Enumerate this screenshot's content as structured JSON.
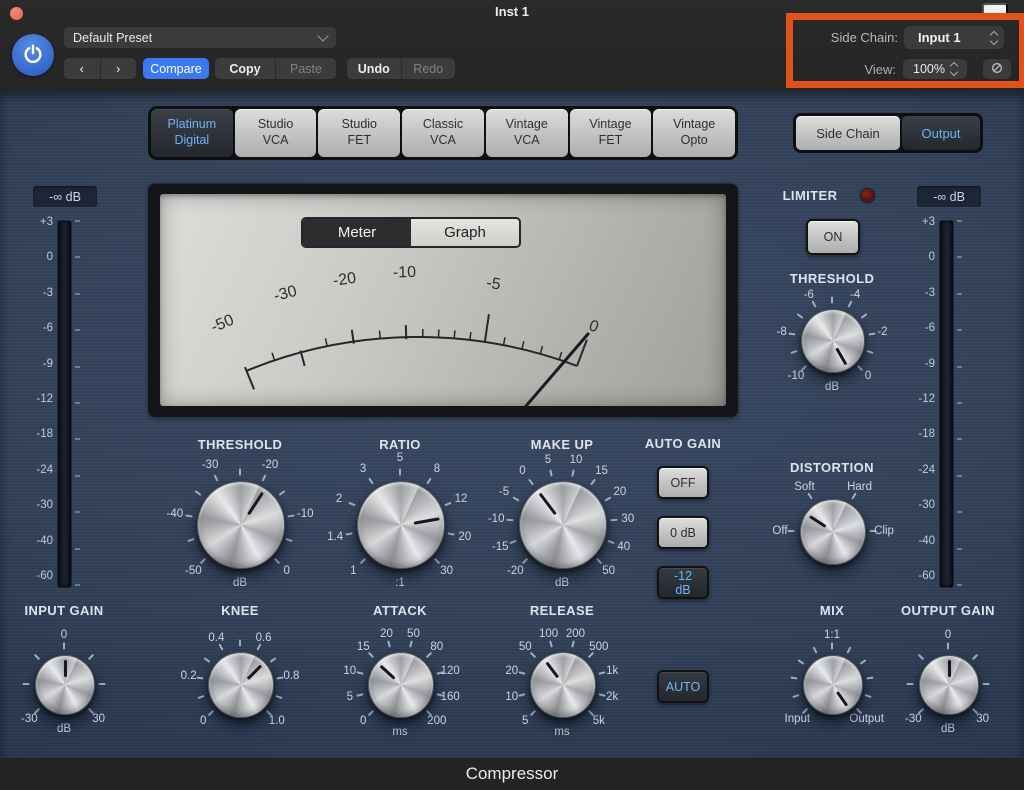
{
  "window": {
    "title": "Inst 1"
  },
  "header": {
    "preset": "Default Preset",
    "prev": "‹",
    "next": "›",
    "compare": "Compare",
    "copy": "Copy",
    "paste": "Paste",
    "undo": "Undo",
    "redo": "Redo",
    "side_chain_label": "Side Chain:",
    "side_chain_value": "Input 1",
    "view_label": "View:",
    "view_value": "100%"
  },
  "models": [
    {
      "label": "Platinum\nDigital",
      "selected": true
    },
    {
      "label": "Studio\nVCA",
      "selected": false
    },
    {
      "label": "Studio\nFET",
      "selected": false
    },
    {
      "label": "Classic\nVCA",
      "selected": false
    },
    {
      "label": "Vintage\nVCA",
      "selected": false
    },
    {
      "label": "Vintage\nFET",
      "selected": false
    },
    {
      "label": "Vintage\nOpto",
      "selected": false
    }
  ],
  "io_toggle": {
    "side_chain": "Side Chain",
    "output": "Output",
    "selected": "Output"
  },
  "vu": {
    "tabs": [
      "Meter",
      "Graph"
    ],
    "selected_tab": "Meter",
    "scale": [
      "-50",
      "-30",
      "-20",
      "-10",
      "-5",
      "0"
    ]
  },
  "limiter": {
    "label": "LIMITER",
    "on": "ON"
  },
  "auto_gain": {
    "label": "AUTO GAIN",
    "options": [
      "OFF",
      "0 dB",
      "-12 dB"
    ],
    "selected": "-12 dB"
  },
  "release_auto": {
    "label": "AUTO",
    "active": true
  },
  "meters": {
    "input": {
      "readout": "-∞ dB",
      "scale": [
        "+3",
        "0",
        "-3",
        "-6",
        "-9",
        "-12",
        "-18",
        "-24",
        "-30",
        "-40",
        "-60"
      ]
    },
    "output": {
      "readout": "-∞ dB",
      "scale": [
        "+3",
        "0",
        "-3",
        "-6",
        "-9",
        "-12",
        "-18",
        "-24",
        "-30",
        "-40",
        "-60"
      ]
    }
  },
  "knobs": {
    "threshold": {
      "title": "THRESHOLD",
      "unit": "dB",
      "pointer": 33,
      "marks": [
        {
          "t": "-50",
          "a": -135
        },
        {
          "t": "-40",
          "a": -81
        },
        {
          "t": "-30",
          "a": -27
        },
        {
          "t": "-20",
          "a": 27
        },
        {
          "t": "-10",
          "a": 81
        },
        {
          "t": "0",
          "a": 135
        }
      ],
      "ticks": [
        -135,
        -108,
        -81,
        -54,
        -27,
        0,
        27,
        54,
        81,
        108,
        135
      ]
    },
    "ratio": {
      "title": "RATIO",
      "unit": ":1",
      "pointer": 80,
      "marks": [
        {
          "t": "1",
          "a": -135
        },
        {
          "t": "1.4",
          "a": -101
        },
        {
          "t": "2",
          "a": -67.5
        },
        {
          "t": "3",
          "a": -34
        },
        {
          "t": "5",
          "a": 0
        },
        {
          "t": "8",
          "a": 34
        },
        {
          "t": "12",
          "a": 67.5
        },
        {
          "t": "20",
          "a": 101
        },
        {
          "t": "30",
          "a": 135
        }
      ],
      "ticks": [
        -135,
        -101,
        -67.5,
        -34,
        0,
        34,
        67.5,
        101,
        135
      ]
    },
    "makeup": {
      "title": "MAKE UP",
      "unit": "dB",
      "pointer": -37,
      "marks": [
        {
          "t": "-20",
          "a": -135
        },
        {
          "t": "-15",
          "a": -110.5
        },
        {
          "t": "-10",
          "a": -86
        },
        {
          "t": "-5",
          "a": -61.4
        },
        {
          "t": "0",
          "a": -36.8
        },
        {
          "t": "5",
          "a": -12.3
        },
        {
          "t": "10",
          "a": 12.3
        },
        {
          "t": "15",
          "a": 36.8
        },
        {
          "t": "20",
          "a": 61.4
        },
        {
          "t": "30",
          "a": 86
        },
        {
          "t": "40",
          "a": 110.5
        },
        {
          "t": "50",
          "a": 135
        }
      ],
      "ticks": [
        -135,
        -110.5,
        -86,
        -61.4,
        -36.8,
        -12.3,
        12.3,
        36.8,
        61.4,
        86,
        110.5,
        135
      ]
    },
    "knee": {
      "title": "KNEE",
      "unit": "",
      "pointer": 45,
      "marks": [
        {
          "t": "0",
          "a": -135
        },
        {
          "t": "0.2",
          "a": -81
        },
        {
          "t": "0.4",
          "a": -27
        },
        {
          "t": "0.6",
          "a": 27
        },
        {
          "t": "0.8",
          "a": 81
        },
        {
          "t": "1.0",
          "a": 135
        }
      ],
      "ticks": [
        -135,
        -108,
        -81,
        -54,
        -27,
        0,
        27,
        54,
        81,
        108,
        135
      ]
    },
    "attack": {
      "title": "ATTACK",
      "unit": "ms",
      "pointer": -48,
      "marks": [
        {
          "t": "0",
          "a": -135
        },
        {
          "t": "5",
          "a": -105
        },
        {
          "t": "10",
          "a": -75
        },
        {
          "t": "15",
          "a": -45
        },
        {
          "t": "20",
          "a": -15
        },
        {
          "t": "50",
          "a": 15
        },
        {
          "t": "80",
          "a": 45
        },
        {
          "t": "120",
          "a": 75
        },
        {
          "t": "160",
          "a": 105
        },
        {
          "t": "200",
          "a": 135
        }
      ],
      "ticks": [
        -135,
        -105,
        -75,
        -45,
        -15,
        15,
        45,
        75,
        105,
        135
      ]
    },
    "release": {
      "title": "RELEASE",
      "unit": "ms",
      "pointer": -37,
      "marks": [
        {
          "t": "5",
          "a": -135
        },
        {
          "t": "10",
          "a": -105
        },
        {
          "t": "20",
          "a": -75
        },
        {
          "t": "50",
          "a": -45
        },
        {
          "t": "100",
          "a": -15
        },
        {
          "t": "200",
          "a": 15
        },
        {
          "t": "500",
          "a": 45
        },
        {
          "t": "1k",
          "a": 75
        },
        {
          "t": "2k",
          "a": 105
        },
        {
          "t": "5k",
          "a": 135
        }
      ],
      "ticks": [
        -135,
        -105,
        -75,
        -45,
        -15,
        15,
        45,
        75,
        105,
        135
      ]
    },
    "limiter_threshold": {
      "title": "THRESHOLD",
      "unit": "dB",
      "pointer": 150,
      "marks": [
        {
          "t": "-10",
          "a": -135
        },
        {
          "t": "-8",
          "a": -81
        },
        {
          "t": "-6",
          "a": -27
        },
        {
          "t": "-4",
          "a": 27
        },
        {
          "t": "-2",
          "a": 81
        },
        {
          "t": "0",
          "a": 135
        }
      ],
      "ticks": [
        -135,
        -108,
        -81,
        -54,
        -27,
        0,
        27,
        54,
        81,
        108,
        135
      ]
    },
    "distortion": {
      "title": "DISTORTION",
      "unit": "",
      "pointer": -57,
      "marks": [
        {
          "t": "Off",
          "a": -90
        },
        {
          "t": "Soft",
          "a": -32
        },
        {
          "t": "Hard",
          "a": 32
        },
        {
          "t": "Clip",
          "a": 90
        }
      ],
      "ticks": [
        -90,
        -32,
        32,
        90
      ]
    },
    "mix": {
      "title": "MIX",
      "unit": "",
      "pointer": 145,
      "marks": [
        {
          "t": "1:1",
          "a": 0
        },
        {
          "t": "Input",
          "a": -135
        },
        {
          "t": "Output",
          "a": 135
        }
      ],
      "ticks": [
        -135,
        -108,
        -81,
        -54,
        -27,
        0,
        27,
        54,
        81,
        108,
        135
      ]
    },
    "input_gain": {
      "title": "INPUT GAIN",
      "unit": "dB",
      "pointer": 0,
      "marks": [
        {
          "t": "0",
          "a": 0
        },
        {
          "t": "-30",
          "a": -135
        },
        {
          "t": "30",
          "a": 135
        }
      ],
      "ticks": [
        -135,
        -90,
        -45,
        0,
        45,
        90,
        135
      ]
    },
    "output_gain": {
      "title": "OUTPUT GAIN",
      "unit": "dB",
      "pointer": 0,
      "marks": [
        {
          "t": "0",
          "a": 0
        },
        {
          "t": "-30",
          "a": -135
        },
        {
          "t": "30",
          "a": 135
        }
      ],
      "ticks": [
        -135,
        -90,
        -45,
        0,
        45,
        90,
        135
      ]
    }
  },
  "footer": {
    "plugin_name": "Compressor"
  },
  "colors": {
    "accent_blue": "#6cb2f4",
    "compare_blue": "#3b78f2",
    "highlight_orange": "#e0521c",
    "led_red": "#5c1210",
    "panel_blue": "#33425a"
  }
}
